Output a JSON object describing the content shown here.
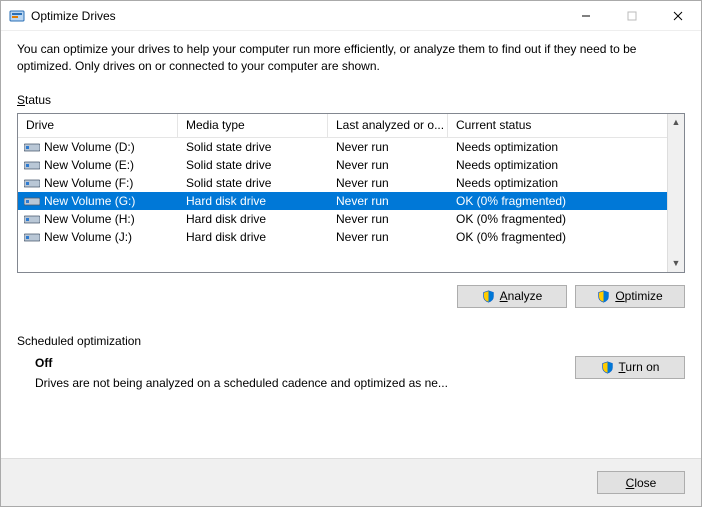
{
  "window": {
    "title": "Optimize Drives"
  },
  "description": "You can optimize your drives to help your computer run more efficiently, or analyze them to find out if they need to be optimized. Only drives on or connected to your computer are shown.",
  "status_label": "Status",
  "columns": {
    "drive": "Drive",
    "media": "Media type",
    "last": "Last analyzed or o...",
    "status": "Current status"
  },
  "drives": [
    {
      "name": "New Volume (D:)",
      "media": "Solid state drive",
      "last": "Never run",
      "status": "Needs optimization",
      "selected": false
    },
    {
      "name": "New Volume (E:)",
      "media": "Solid state drive",
      "last": "Never run",
      "status": "Needs optimization",
      "selected": false
    },
    {
      "name": "New Volume (F:)",
      "media": "Solid state drive",
      "last": "Never run",
      "status": "Needs optimization",
      "selected": false
    },
    {
      "name": "New Volume (G:)",
      "media": "Hard disk drive",
      "last": "Never run",
      "status": "OK (0% fragmented)",
      "selected": true
    },
    {
      "name": "New Volume (H:)",
      "media": "Hard disk drive",
      "last": "Never run",
      "status": "OK (0% fragmented)",
      "selected": false
    },
    {
      "name": "New Volume (J:)",
      "media": "Hard disk drive",
      "last": "Never run",
      "status": "OK (0% fragmented)",
      "selected": false
    }
  ],
  "buttons": {
    "analyze": "Analyze",
    "analyze_key": "A",
    "optimize": "Optimize",
    "optimize_key": "O",
    "turn_on": "Turn on",
    "turn_on_key": "T",
    "close": "Close",
    "close_key": "C"
  },
  "scheduled": {
    "label": "Scheduled optimization",
    "state": "Off",
    "detail": "Drives are not being analyzed on a scheduled cadence and optimized as ne..."
  }
}
